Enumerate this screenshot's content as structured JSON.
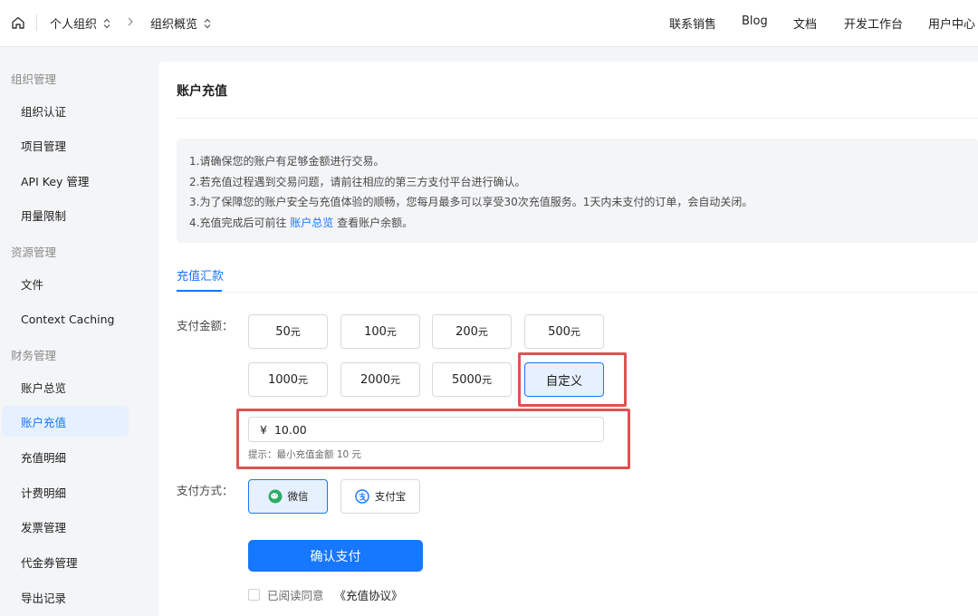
{
  "header": {
    "org": "个人组织",
    "page": "组织概览",
    "nav": [
      "联系销售",
      "Blog",
      "文档",
      "开发工作台",
      "用户中心"
    ]
  },
  "sidebar": {
    "groups": [
      {
        "label": "组织管理",
        "items": [
          "组织认证",
          "项目管理",
          "API Key 管理",
          "用量限制"
        ]
      },
      {
        "label": "资源管理",
        "items": [
          "文件",
          "Context Caching"
        ]
      },
      {
        "label": "财务管理",
        "items": [
          "账户总览",
          "账户充值",
          "充值明细",
          "计费明细",
          "发票管理",
          "代金券管理",
          "导出记录"
        ]
      }
    ],
    "active_item": "账户充值"
  },
  "main": {
    "title": "账户充值",
    "notice": {
      "line1": "1.请确保您的账户有足够金额进行交易。",
      "line2": "2.若充值过程遇到交易问题，请前往相应的第三方支付平台进行确认。",
      "line3": "3.为了保障您的账户安全与充值体验的顺畅，您每月最多可以享受30次充值服务。1天内未支付的订单，会自动关闭。",
      "line4_prefix": "4.充值完成后可前往 ",
      "line4_link": "账户总览",
      "line4_suffix": " 查看账户余额。"
    },
    "tab": "充值汇款",
    "amount_label": "支付金额：",
    "amounts": [
      {
        "value": "50",
        "unit": "元"
      },
      {
        "value": "100",
        "unit": "元"
      },
      {
        "value": "200",
        "unit": "元"
      },
      {
        "value": "500",
        "unit": "元"
      },
      {
        "value": "1000",
        "unit": "元"
      },
      {
        "value": "2000",
        "unit": "元"
      },
      {
        "value": "5000",
        "unit": "元"
      }
    ],
    "custom_label": "自定义",
    "currency": "¥",
    "amount_value": "10.00",
    "hint": "提示：最小充值金额 10 元",
    "pay_label": "支付方式：",
    "pay_wechat": "微信",
    "pay_alipay": "支付宝",
    "confirm": "确认支付",
    "agree_text": "已阅读同意",
    "agree_link": "《充值协议》"
  },
  "colors": {
    "accent": "#1677ff",
    "selected_bg": "#e6f0ff",
    "highlight_box": "#e05252",
    "wechat": "#2aae67",
    "alipay": "#1677ff"
  }
}
